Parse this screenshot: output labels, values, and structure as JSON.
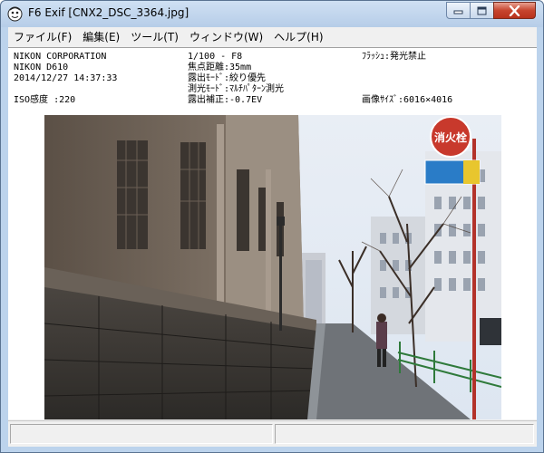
{
  "window": {
    "title": "F6 Exif [CNX2_DSC_3364.jpg]",
    "icons": {
      "app": "app-face-icon",
      "minimize": "minimize-icon",
      "maximize": "maximize-icon",
      "close": "close-icon"
    },
    "accent_color": "#bcd3ec"
  },
  "menu": {
    "items": [
      "ファイル(F)",
      "編集(E)",
      "ツール(T)",
      "ウィンドウ(W)",
      "ヘルプ(H)"
    ]
  },
  "exif": {
    "make": "NIKON CORPORATION",
    "model": "NIKON D610",
    "datetime": "2014/12/27 14:37:33",
    "iso": "ISO感度 :220",
    "shutter_aperture": "1/100 - F8",
    "focal_length": "焦点距離:35mm",
    "exposure_mode": "露出ﾓｰﾄﾞ:絞り優先",
    "metering_mode": "測光ﾓｰﾄﾞ:ﾏﾙﾁﾊﾟﾀｰﾝ測光",
    "exposure_comp": "露出補正:-0.7EV",
    "flash": "ﾌﾗｯｼｭ:発光禁止",
    "image_size": "画像ｻｲｽﾞ:6016×4016"
  },
  "photo": {
    "sign_text": "消火栓"
  },
  "status": {
    "panes": [
      "",
      ""
    ]
  }
}
